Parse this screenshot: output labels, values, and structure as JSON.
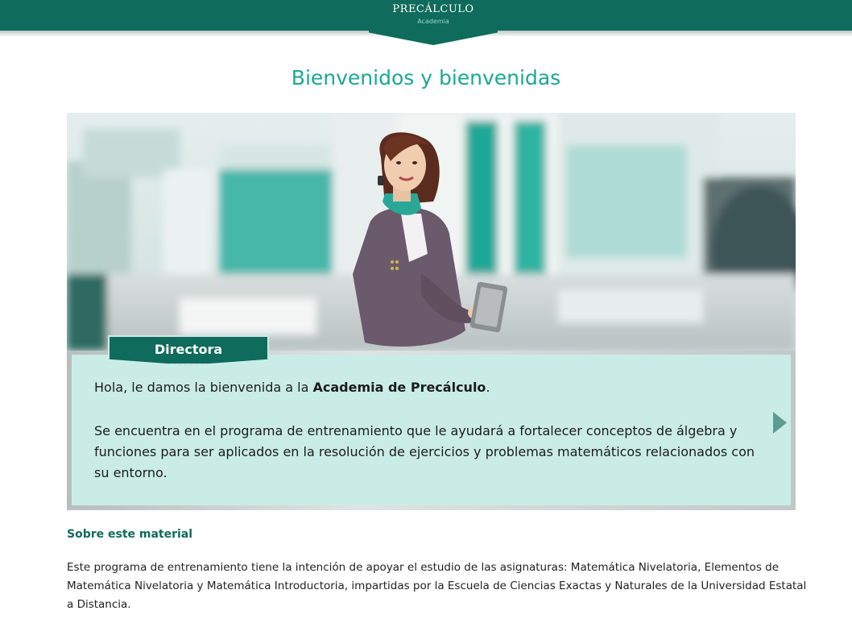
{
  "header": {
    "logo_title": "PRECÁLCULO",
    "logo_subtitle": "Academia"
  },
  "page": {
    "title": "Bienvenidos y bienvenidas"
  },
  "dialog": {
    "speaker": "Directora",
    "greeting_prefix": "Hola, le damos la bienvenida a la ",
    "greeting_bold": "Academia de Precálculo",
    "greeting_suffix": ".",
    "body": "Se encuentra en el programa de entrenamiento que le ayudará a fortalecer conceptos de álgebra y funciones para ser aplicados en la resolución de ejercicios y problemas matemáticos relacionados con su entorno.",
    "next_icon": "triangle-right-icon"
  },
  "about": {
    "heading": "Sobre este material",
    "text": "Este programa de entrenamiento tiene la intención de apoyar el estudio de las asignaturas: Matemática Nivelatoria, Elementos de Matemática Nivelatoria y Matemática Introductoria, impartidas por la Escuela de Ciencias Exactas y Naturales de la Universidad Estatal a Distancia."
  },
  "colors": {
    "brand": "#0f6b5c",
    "accent": "#1aa894",
    "panel": "#caece7"
  }
}
